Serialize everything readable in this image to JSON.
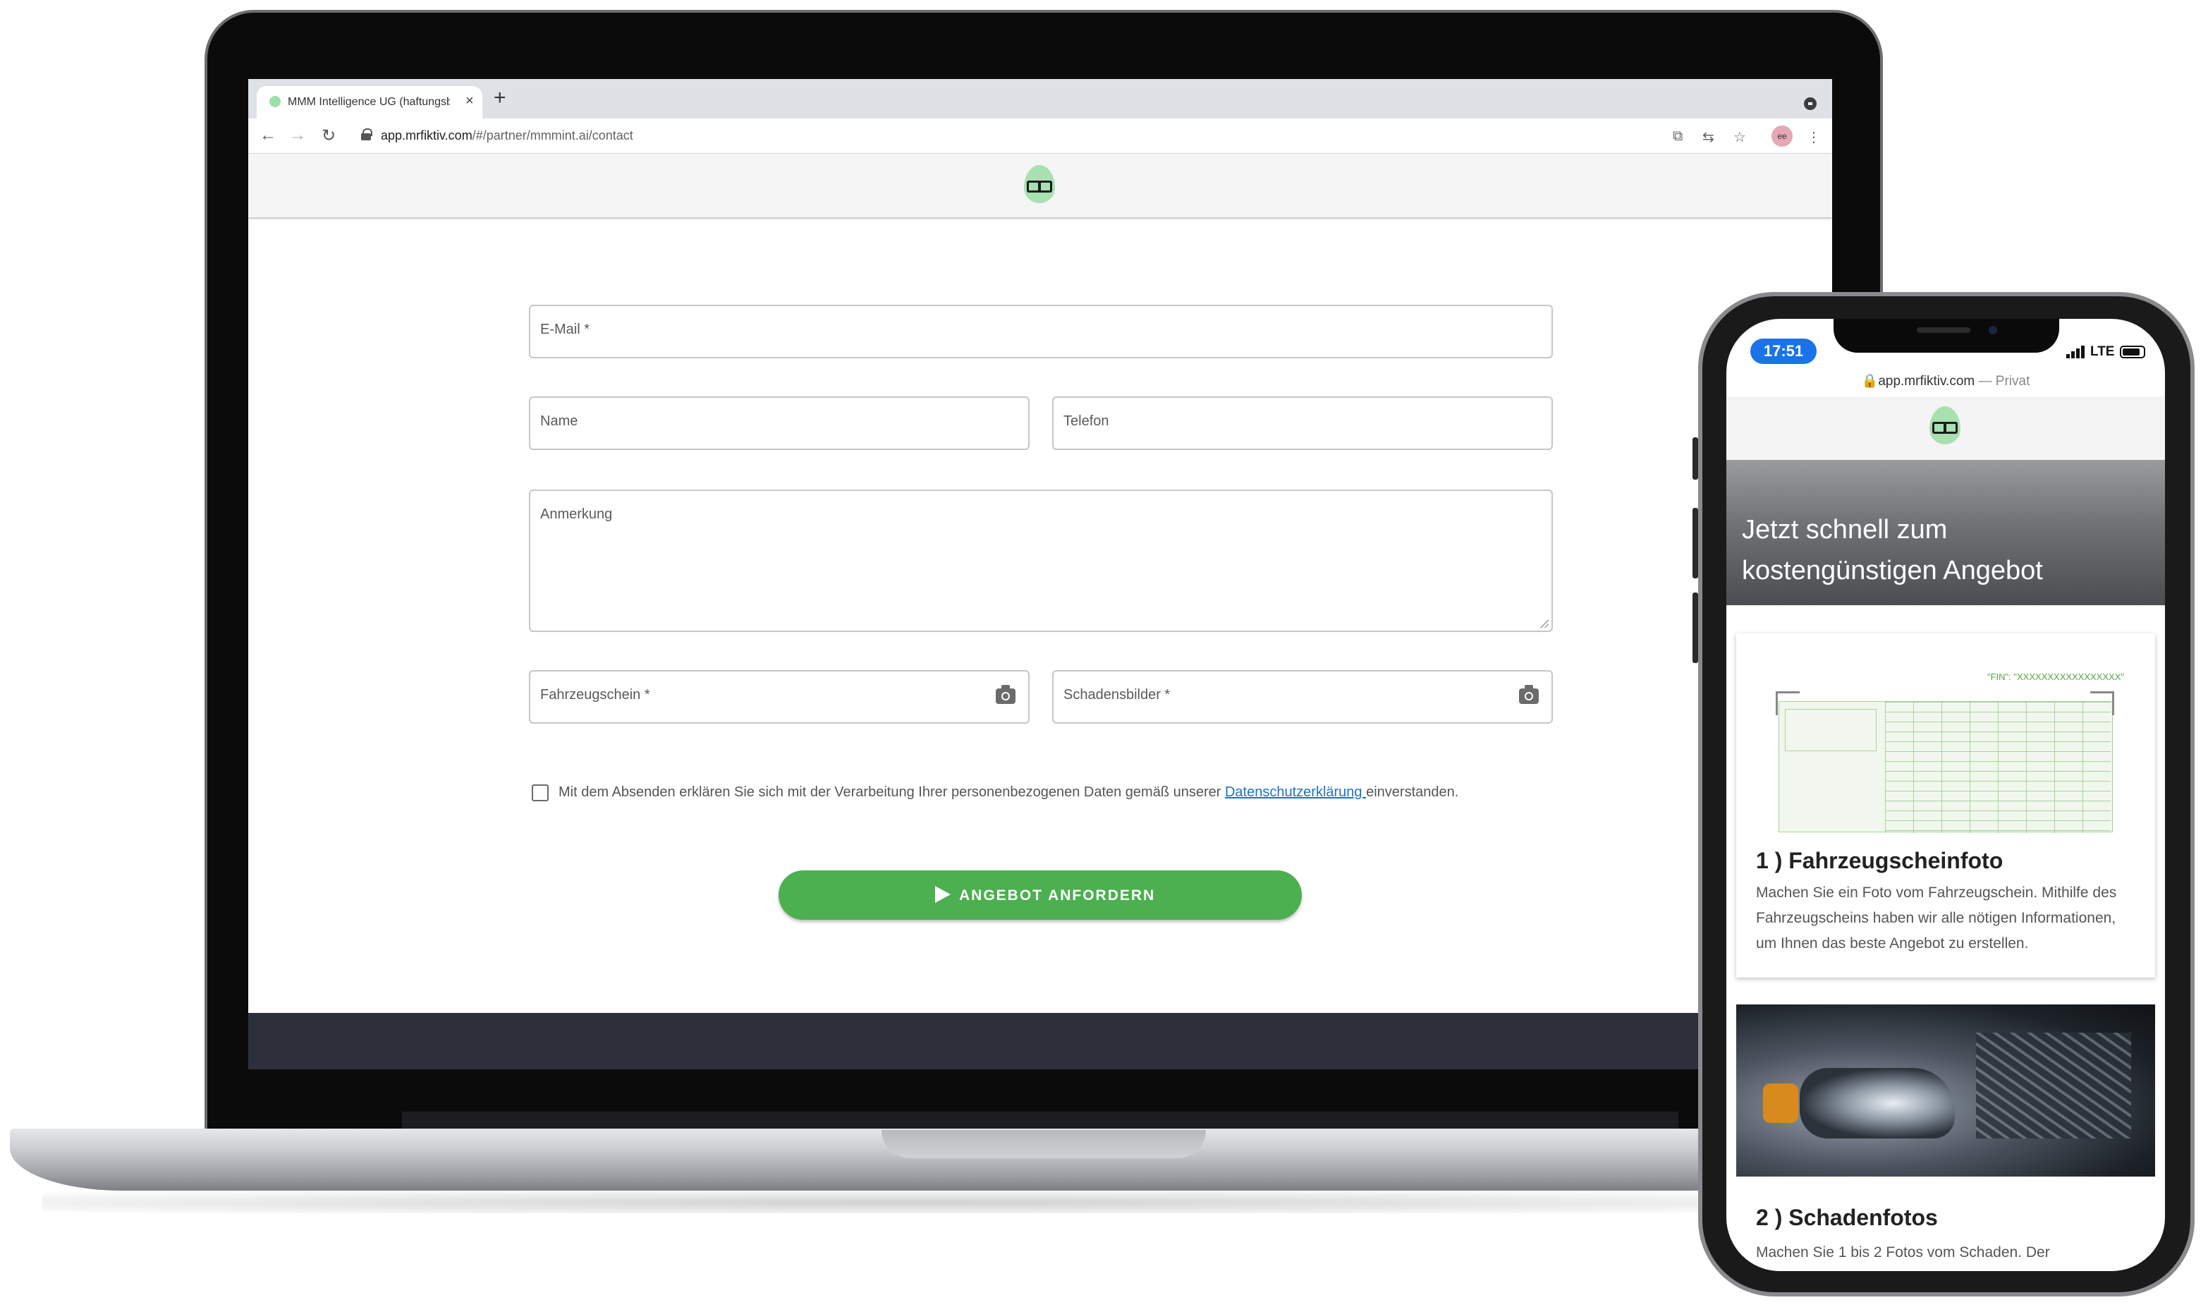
{
  "browser": {
    "tab_title": "MMM Intelligence UG (haftungsbeschränkt)",
    "tab_close": "×",
    "new_tab": "+",
    "url_host": "app.mrfiktiv.com",
    "url_path": "/#/partner/mmmint.ai/contact",
    "nav_back": "←",
    "nav_forward": "→",
    "nav_reload": "↻",
    "profile_initials": "ee",
    "star": "☆",
    "menu": "⋮",
    "icon_names": [
      "install-icon",
      "translate-icon",
      "bookmark-star-icon",
      "profile-avatar",
      "menu-icon"
    ]
  },
  "contact_form": {
    "email_label": "E-Mail *",
    "name_label": "Name",
    "phone_label": "Telefon",
    "note_label": "Anmerkung",
    "registration_label": "Fahrzeugschein *",
    "damage_images_label": "Schadensbilder *",
    "consent_prefix": "Mit dem Absenden erklären Sie sich mit der Verarbeitung Ihrer personenbezogenen Daten gemäß unserer ",
    "consent_link": "Datenschutzerklärung ",
    "consent_suffix": "einverstanden.",
    "submit_label": "ANGEBOT ANFORDERN"
  },
  "mobile": {
    "time": "17:51",
    "network": "LTE",
    "url_host": "app.mrfiktiv.com",
    "url_private": " — Privat",
    "hero_title": "Jetzt schnell zum kostengünstigen Angebot",
    "steps": [
      {
        "title": "1 ) Fahrzeugscheinfoto",
        "description": "Machen Sie ein Foto vom Fahrzeugschein. Mithilfe des Fahrzeugscheins haben wir alle nötigen Informationen, um Ihnen das beste Angebot zu erstellen."
      },
      {
        "title": "2 ) Schadenfotos",
        "description": "Machen Sie 1 bis 2 Fotos vom Schaden. Der"
      }
    ],
    "doc_fin_text": "\"FIN\": \"XXXXXXXXXXXXXXXXX\""
  },
  "colors": {
    "accent_green": "#4caf50",
    "link_blue": "#1a73c8",
    "footer_dark": "#2d303b",
    "logo_green": "#a8e0b0"
  }
}
